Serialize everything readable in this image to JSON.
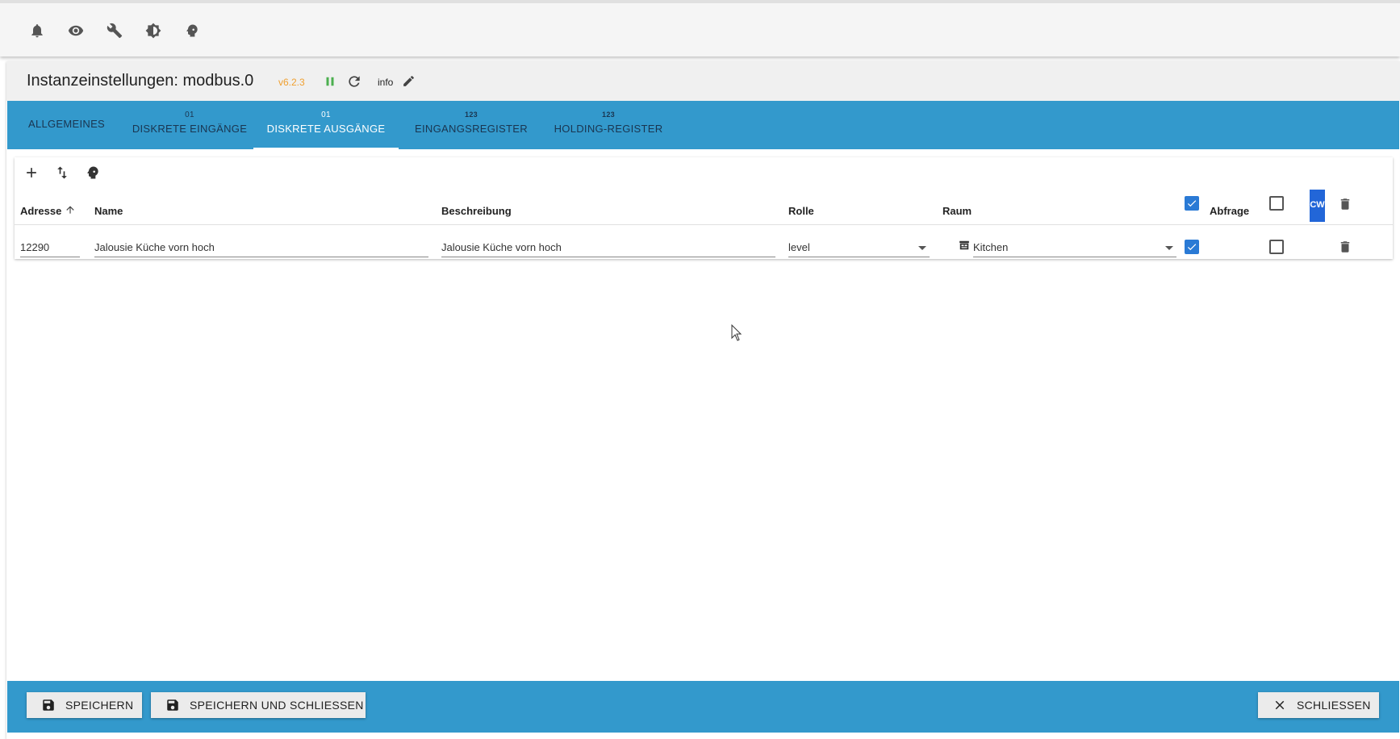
{
  "topbar": {
    "icons": [
      "bell-icon",
      "eye-icon",
      "wrench-icon",
      "brightness-icon",
      "expert-mode-icon"
    ]
  },
  "header": {
    "title": "Instanzeinstellungen: modbus.0",
    "version": "v6.2.3",
    "info_label": "info",
    "version_color": "#f0a030"
  },
  "tabs": [
    {
      "sup": "",
      "label": "ALLGEMEINES",
      "active": false
    },
    {
      "sup": "01",
      "label": "DISKRETE EINGÄNGE",
      "active": false
    },
    {
      "sup": "01",
      "label": "DISKRETE AUSGÄNGE",
      "active": true
    },
    {
      "sup": "123",
      "label": "EINGANGSREGISTER",
      "active": false
    },
    {
      "sup": "123",
      "label": "HOLDING-REGISTER",
      "active": false
    }
  ],
  "table": {
    "headers": {
      "address": "Adresse",
      "name": "Name",
      "description": "Beschreibung",
      "role": "Rolle",
      "room": "Raum",
      "poll": "Abfrage",
      "cw": "CW"
    },
    "rows": [
      {
        "address": "12290",
        "name": "Jalousie Küche vorn hoch",
        "description": "Jalousie Küche vorn hoch",
        "role": "level",
        "room": "Kitchen",
        "poll": true,
        "cw": false
      }
    ]
  },
  "footer": {
    "save": "SPEICHERN",
    "save_close": "SPEICHERN UND SCHLIESSEN",
    "close": "SCHLIESSEN"
  },
  "colors": {
    "accent": "#3399cc",
    "checkbox": "#2a7ad5",
    "cw_badge": "#2266d8"
  }
}
